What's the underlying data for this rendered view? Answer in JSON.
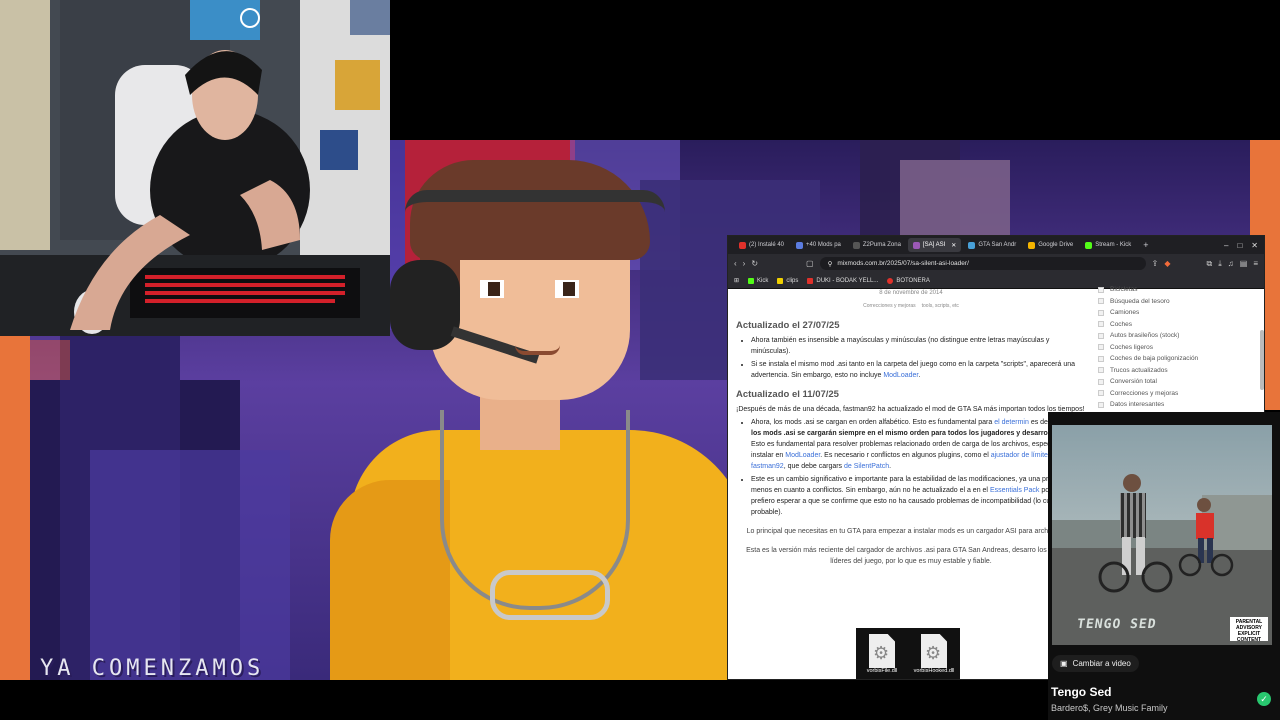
{
  "overlay": {
    "text": "YA COMENZAMOS"
  },
  "browser": {
    "tabs": [
      {
        "label": "(2) Instalé 40",
        "color": "#e0312b"
      },
      {
        "label": "+40 Mods pa",
        "color": "#5b7ce0"
      },
      {
        "label": "Z2Puma Zona",
        "color": "#3a3a3a"
      },
      {
        "label": "[SA] ASI",
        "color": "#9b59b6",
        "active": true
      },
      {
        "label": "GTA San Andr",
        "color": "#48a0d8"
      },
      {
        "label": "Google Drive",
        "color": "#f5b400"
      },
      {
        "label": "Stream - Kick",
        "color": "#53fc18"
      }
    ],
    "new_tab": "+",
    "window_controls": {
      "minimize": "–",
      "maximize": "□",
      "close": "✕"
    },
    "url": "mixmods.com.br/2025/07/sa-silent-asi-loader/",
    "bookmarks": [
      {
        "label": "Kick",
        "color": "#53fc18"
      },
      {
        "label": "clips",
        "color": "#f0d000"
      },
      {
        "label": "DUKI - BODAK YELL...",
        "color": "#e0312b"
      },
      {
        "label": "BOTONERA",
        "color": "#e0312b"
      }
    ]
  },
  "article": {
    "date": "8 de novembre de 2014",
    "tags": [
      "Correcciones y mejoras",
      "tools, scripts, etc"
    ],
    "section1_title": "Actualizado el 27/07/25",
    "section1_items": [
      "Ahora también es insensible a mayúsculas y minúsculas (no distingue entre letras mayúsculas y minúsculas).",
      "Si se instala el mismo mod .asi tanto en la carpeta del juego como en la carpeta \"scripts\", aparecerá una advertencia. Sin embargo, esto no incluye",
      "ModLoader"
    ],
    "section2_title": "Actualizado el 11/07/25",
    "section2_intro": "¡Después de más de una década, fastman92 ha actualizado el mod de GTA SA más importan todos los tiempos!",
    "section2_item1_a": "Ahora, los mods .asi se cargan en orden alfabético. Esto es fundamental para",
    "section2_item1_link": "el determin",
    "section2_item1_b": "es decir,",
    "section2_item1_bold": "todos los mods .asi se cargarán siempre en el mismo orden para todos los jugadores y desarrolladores",
    "section2_item1_c": ". Esto es fundamental para resolver problemas relacionado orden de carga de los archivos, especialmente al instalar en",
    "section2_item1_link2": "ModLoader",
    "section2_item1_d": ". Es necesario r conflictos en algunos plugins, como el",
    "section2_item1_link3": "ajustador de límites fastman92",
    "section2_item1_e": ", que debe cargars",
    "section2_item1_link4": "de SilentPatch",
    "section2_item2_a": "Este es un cambio significativo e importante para la estabilidad de las modificaciones, ya una preocupación menos en cuanto a conflictos. Sin embargo, aún no he actualizado el a en el",
    "section2_item2_link": "Essentials Pack",
    "section2_item2_b": "porque prefiero esperar a que se confirme que esto no ha causado problemas de incompatibilidad (lo cual es poco probable).",
    "para1": "Lo principal que necesitas en tu GTA para empezar a instalar mods es un cargador ASI para archivos .asi.",
    "para2": "Esta es la versión más reciente del cargador de archivos .asi para GTA San Andreas, desarro los modders líderes del juego, por lo que es muy estable y fiable.",
    "files": [
      "vorbisFile.dll",
      "vorbisHooked.dll"
    ]
  },
  "sidebar": {
    "items": [
      "Bicicletas",
      "Búsqueda del tesoro",
      "Camiones",
      "Coches",
      "Autos brasileños (stock)",
      "Coches ligeros",
      "Coches de baja poligonización",
      "Trucos actualizados",
      "Conversión total",
      "Correcciones y mejoras",
      "Datos interesantes"
    ]
  },
  "music": {
    "cover_title": "TENGO SED",
    "advisory": "PARENTAL ADVISORY EXPLICIT CONTENT",
    "change_video": "Cambiar a video",
    "song_title": "Tengo Sed",
    "artist": "Bardero$, Grey Music Family"
  },
  "colors": {
    "accent_orange": "#e8743a",
    "bg_purple": "#5b3fa0",
    "spotify_green": "#28c76f"
  }
}
